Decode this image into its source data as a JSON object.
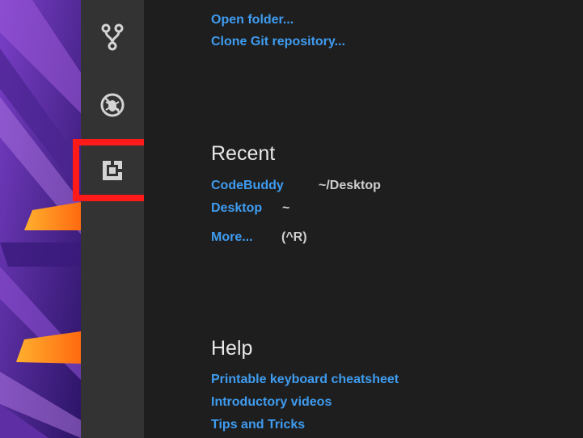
{
  "start": {
    "open_folder": "Open folder...",
    "clone_repo": "Clone Git repository..."
  },
  "recent": {
    "title": "Recent",
    "items": [
      {
        "name": "CodeBuddy",
        "path": "~/Desktop"
      },
      {
        "name": "Desktop",
        "path": "~"
      }
    ],
    "more_label": "More...",
    "more_shortcut": "(^R)"
  },
  "help": {
    "title": "Help",
    "links": [
      "Printable keyboard cheatsheet",
      "Introductory videos",
      "Tips and Tricks"
    ]
  },
  "activity_bar": {
    "icons": [
      "source-control-icon",
      "debug-icon",
      "extensions-icon"
    ],
    "highlighted": "extensions-icon"
  },
  "colors": {
    "link": "#3f9cf0",
    "highlight_border": "#ff1a1a",
    "activity_bar_bg": "#333333",
    "editor_bg": "#1e1e1e"
  }
}
